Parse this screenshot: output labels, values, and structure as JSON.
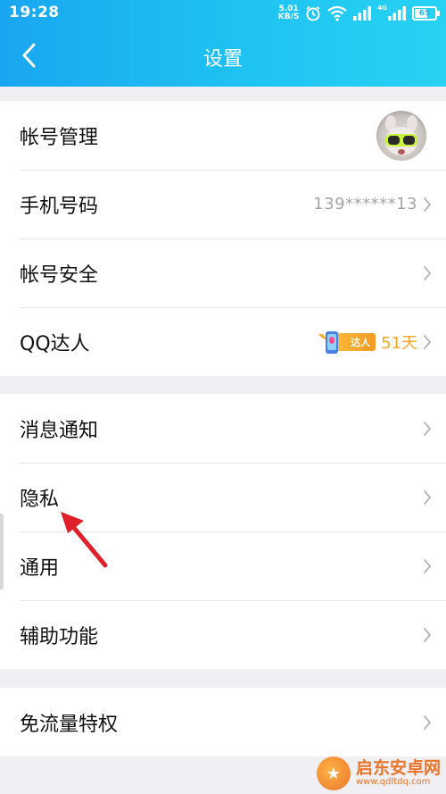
{
  "status_bar": {
    "time": "19:28",
    "speed_value": "5.01",
    "speed_unit": "KB/S",
    "network_label": "4G",
    "battery_level": 65,
    "battery_text": "65"
  },
  "header": {
    "title": "设置",
    "back_icon": "chevron-left-icon"
  },
  "groups": [
    {
      "items": [
        {
          "label": "帐号管理",
          "right": "avatar"
        },
        {
          "label": "手机号码",
          "value": "139******13"
        },
        {
          "label": "帐号安全"
        },
        {
          "label": "QQ达人",
          "badge": "达人",
          "days": "51天"
        }
      ]
    },
    {
      "items": [
        {
          "label": "消息通知"
        },
        {
          "label": "隐私"
        },
        {
          "label": "通用"
        },
        {
          "label": "辅助功能"
        }
      ]
    },
    {
      "items": [
        {
          "label": "免流量特权"
        }
      ]
    }
  ],
  "watermark": {
    "title": "启东安卓网",
    "url": "www.qdltdq.com"
  },
  "colors": {
    "header_start": "#19a6f0",
    "header_end": "#27d2f2",
    "days_color": "#f5a623",
    "annotation_arrow": "#e0202a"
  }
}
